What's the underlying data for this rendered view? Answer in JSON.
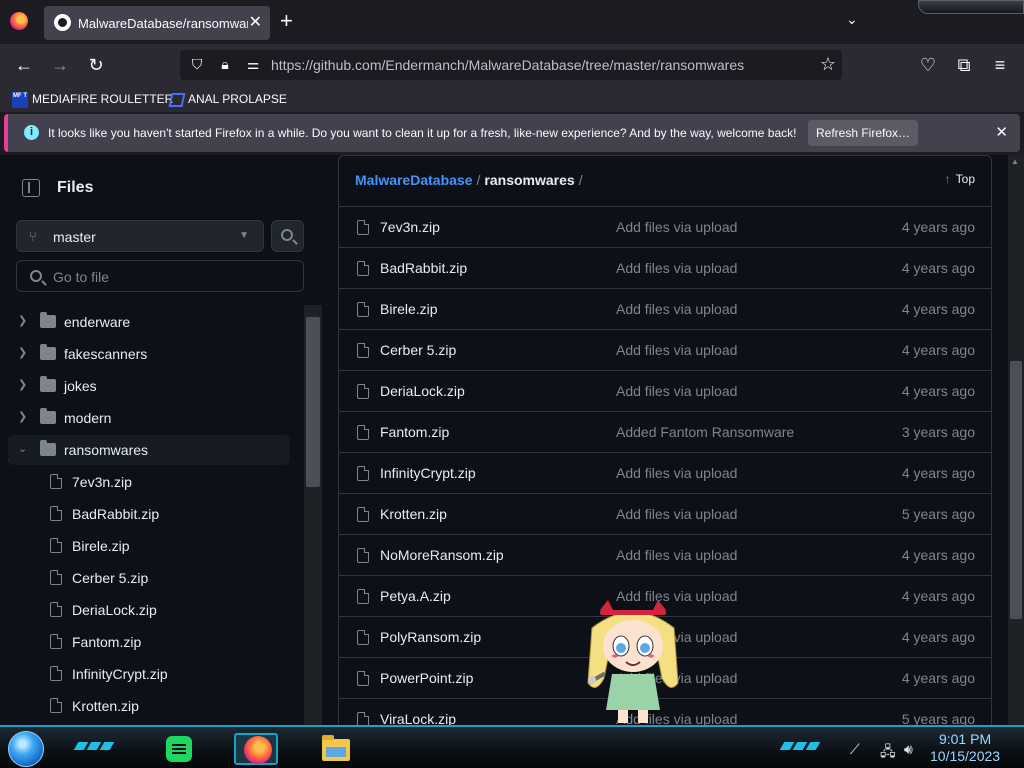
{
  "browser": {
    "tab": {
      "title": "MalwareDatabase/ransomwares at master · Endermanch/MalwareDatabase"
    },
    "url": "https://github.com/Endermanch/MalwareDatabase/tree/master/ransomwares",
    "bookmarks": [
      {
        "label": "MEDIAFIRE ROULETTER",
        "icon_text": "MF T"
      },
      {
        "label": "ANAL PROLAPSE"
      }
    ],
    "notification": {
      "message": "It looks like you haven't started Firefox in a while. Do you want to clean it up for a fresh, like-new experience? And by the way, welcome back!",
      "button": "Refresh Firefox…"
    }
  },
  "sidebar": {
    "title": "Files",
    "branch": "master",
    "search_placeholder": "Go to file",
    "tree": [
      {
        "type": "folder",
        "name": "enderware",
        "expanded": false
      },
      {
        "type": "folder",
        "name": "fakescanners",
        "expanded": false
      },
      {
        "type": "folder",
        "name": "jokes",
        "expanded": false
      },
      {
        "type": "folder",
        "name": "modern",
        "expanded": false
      },
      {
        "type": "folder",
        "name": "ransomwares",
        "expanded": true,
        "active": true
      },
      {
        "type": "file",
        "name": "7ev3n.zip"
      },
      {
        "type": "file",
        "name": "BadRabbit.zip"
      },
      {
        "type": "file",
        "name": "Birele.zip"
      },
      {
        "type": "file",
        "name": "Cerber 5.zip"
      },
      {
        "type": "file",
        "name": "DeriaLock.zip"
      },
      {
        "type": "file",
        "name": "Fantom.zip"
      },
      {
        "type": "file",
        "name": "InfinityCrypt.zip"
      },
      {
        "type": "file",
        "name": "Krotten.zip"
      }
    ]
  },
  "main": {
    "breadcrumb": {
      "repo": "MalwareDatabase",
      "separator": "/",
      "dir": "ransomwares"
    },
    "top_label": "Top",
    "files": [
      {
        "name": "7ev3n.zip",
        "commit": "Add files via upload",
        "age": "4 years ago"
      },
      {
        "name": "BadRabbit.zip",
        "commit": "Add files via upload",
        "age": "4 years ago"
      },
      {
        "name": "Birele.zip",
        "commit": "Add files via upload",
        "age": "4 years ago"
      },
      {
        "name": "Cerber 5.zip",
        "commit": "Add files via upload",
        "age": "4 years ago"
      },
      {
        "name": "DeriaLock.zip",
        "commit": "Add files via upload",
        "age": "4 years ago"
      },
      {
        "name": "Fantom.zip",
        "commit": "Added Fantom Ransomware",
        "age": "3 years ago"
      },
      {
        "name": "InfinityCrypt.zip",
        "commit": "Add files via upload",
        "age": "4 years ago"
      },
      {
        "name": "Krotten.zip",
        "commit": "Add files via upload",
        "age": "5 years ago"
      },
      {
        "name": "NoMoreRansom.zip",
        "commit": "Add files via upload",
        "age": "4 years ago"
      },
      {
        "name": "Petya.A.zip",
        "commit": "Add files via upload",
        "age": "4 years ago"
      },
      {
        "name": "PolyRansom.zip",
        "commit": "Add files via upload",
        "age": "4 years ago"
      },
      {
        "name": "PowerPoint.zip",
        "commit": "Add files via upload",
        "age": "4 years ago"
      },
      {
        "name": "ViraLock.zip",
        "commit": "Add files via upload",
        "age": "5 years ago"
      }
    ]
  },
  "taskbar": {
    "time": "9:01 PM",
    "date": "10/15/2023",
    "apps": [
      {
        "icon": "spotify-icon"
      },
      {
        "icon": "firefox-icon",
        "active": true
      },
      {
        "icon": "file-explorer-icon"
      }
    ]
  },
  "colors": {
    "accent_link": "#4493f8",
    "active_indicator": "#2f81f7",
    "notification_accent": "#e73f95",
    "taskbar_accent": "#1aa0c9"
  }
}
